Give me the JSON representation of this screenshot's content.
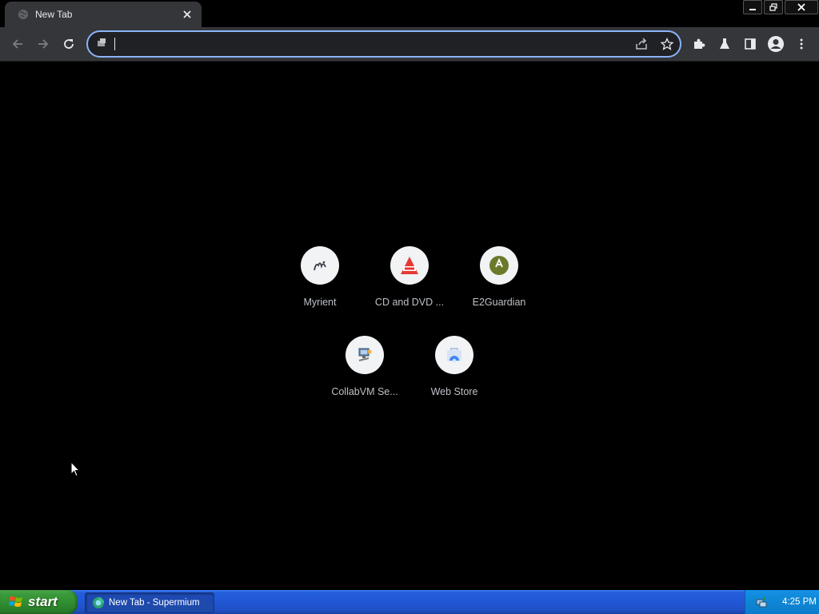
{
  "browser": {
    "tab": {
      "title": "New Tab",
      "favicon": "globe-icon",
      "close_icon": "close-icon"
    },
    "window_controls": [
      "minimize-icon",
      "restore-icon",
      "close-icon"
    ],
    "toolbar": {
      "back": "back-arrow-icon",
      "forward": "forward-arrow-icon",
      "reload": "reload-icon",
      "omnibox": {
        "value": "",
        "placeholder": "",
        "left_icon": "search-icon"
      },
      "omnibox_actions": [
        "share-icon",
        "bookmark-star-icon"
      ],
      "right_actions": [
        "extensions-puzzle-icon",
        "labs-flask-icon",
        "side-panel-icon",
        "profile-avatar-icon",
        "menu-kebab-icon"
      ]
    }
  },
  "shortcuts": [
    {
      "label": "Myrient",
      "icon": "myrient-icon"
    },
    {
      "label": "CD and DVD ...",
      "icon": "cd-dvd-icon"
    },
    {
      "label": "E2Guardian",
      "icon": "e2guardian-icon"
    },
    {
      "label": "CollabVM Se...",
      "icon": "collabvm-icon"
    },
    {
      "label": "Web Store",
      "icon": "web-store-icon"
    }
  ],
  "taskbar": {
    "start_label": "start",
    "task_item": "New Tab - Supermium",
    "clock": "4:25 PM"
  },
  "colors": {
    "accent": "#8ab4f8",
    "toolbar_bg": "#35363a",
    "page_bg": "#000000",
    "taskbar_blue": "#245edb",
    "start_green": "#3c9a3c"
  }
}
